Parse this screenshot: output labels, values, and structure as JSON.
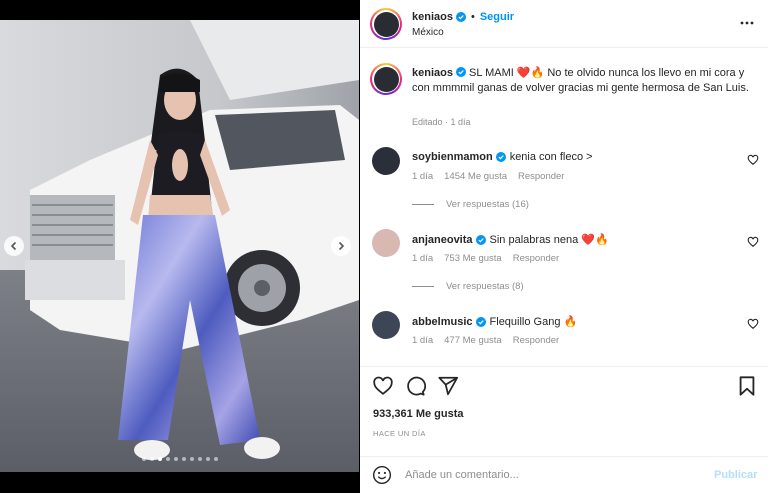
{
  "post": {
    "author": "keniaos",
    "follow_label": "Seguir",
    "location": "México",
    "caption_username": "keniaos",
    "caption_text": "SL MAMI ❤️🔥 No te olvido nunca los llevo en mi cora y con mmmmil ganas de volver gracias mi gente hermosa de San Luis.",
    "caption_meta": "Editado · 1 día",
    "likes": "933,361 Me gusta",
    "timestamp": "HACE UN DÍA"
  },
  "carousel": {
    "total_slides": 10,
    "active_index": 2
  },
  "comments": [
    {
      "username": "soybienmamon",
      "text": "kenia con fleco >",
      "age": "1 día",
      "likes": "1454 Me gusta",
      "reply_label": "Responder",
      "replies": "Ver respuestas (16)",
      "avatar_color": "#2a2f3a"
    },
    {
      "username": "anjaneovita",
      "text": "Sin palabras nena ❤️🔥",
      "age": "1 día",
      "likes": "753 Me gusta",
      "reply_label": "Responder",
      "replies": "Ver respuestas (8)",
      "avatar_color": "#d8b8b0"
    },
    {
      "username": "abbelmusic",
      "text": "Flequillo Gang 🔥",
      "age": "1 día",
      "likes": "477 Me gusta",
      "reply_label": "Responder",
      "replies": "",
      "avatar_color": "#3d4656"
    }
  ],
  "composer": {
    "placeholder": "Añade un comentario...",
    "publish_label": "Publicar"
  },
  "icons": {
    "header": [
      "verified-badge-icon",
      "more-options-icon"
    ],
    "actions": [
      "like-heart-icon",
      "comment-icon",
      "share-icon",
      "save-bookmark-icon"
    ],
    "composer": "emoji-icon"
  },
  "colors": {
    "link": "#0095f6",
    "muted": "#8e8e8e",
    "publish_disabled": "#b2dffc",
    "text": "#262626"
  }
}
